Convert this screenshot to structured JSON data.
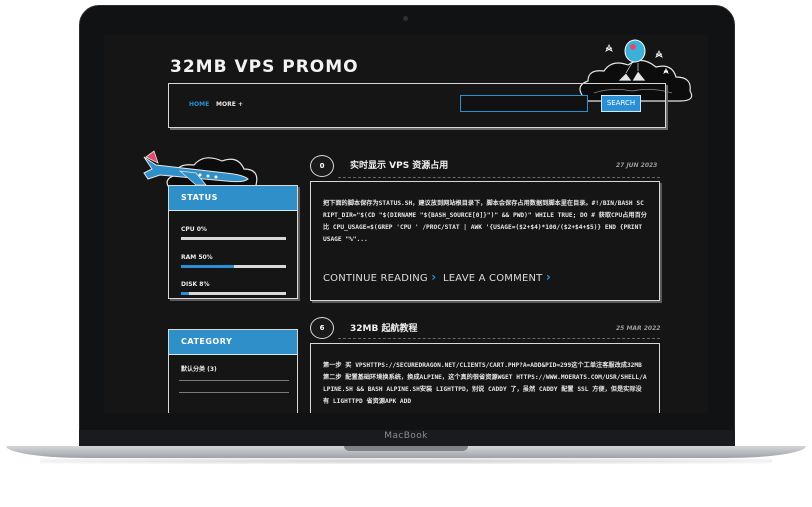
{
  "device": {
    "brand": "MacBook"
  },
  "site": {
    "title": "32MB VPS PROMO"
  },
  "nav": {
    "home": "HOME",
    "more": "MORE +"
  },
  "search": {
    "value": "",
    "button": "SEARCH"
  },
  "status": {
    "heading": "STATUS",
    "items": [
      {
        "label": "CPU 0%",
        "value": 0
      },
      {
        "label": "RAM 50%",
        "value": 50
      },
      {
        "label": "DISK 8%",
        "value": 8
      }
    ]
  },
  "category": {
    "heading": "CATEGORY",
    "items": [
      "默认分类 (3)"
    ]
  },
  "posts": [
    {
      "comments": "0",
      "title": "实时显示 VPS 资源占用",
      "date": "27 JUN 2023",
      "excerpt": "把下面的脚本保存为STATUS.SH，建议放到网站根目录下，脚本会保存占用数据到脚本里在目录。#!/BIN/BASH SCRIPT_DIR=\"$(CD \"$(DIRNAME \"${BASH_SOURCE[0]}\")\" && PWD)\" WHILE TRUE; DO # 获取CPU占用百分比 CPU_USAGE=$(GREP 'CPU ' /PROC/STAT | AWK '{USAGE=($2+$4)*100/($2+$4+$5)} END {PRINT USAGE \"%\"...",
      "continue": "CONTINUE READING",
      "comment": "LEAVE A COMMENT"
    },
    {
      "comments": "6",
      "title": "32MB 起航教程",
      "date": "25 MAR 2022",
      "excerpt": "第一步 买 VPSHTTPS://SECUREDRAGON.NET/CLIENTS/CART.PHP?A=ADD&PID=299这个工单注客服改成32MB第二步 配置基础环境换系统，换成ALPINE，这个真的很省资源WGET HTTPS://WWW.MOERATS.COM/USR/SHELL/ALPINE.SH && BASH ALPINE.SH安装 LIGHTTPD，别说 CADDY 了，虽然 CADDY 配置 SSL 方便，但是实际没有 LIGHTTPD 省资源APK ADD"
    }
  ]
}
